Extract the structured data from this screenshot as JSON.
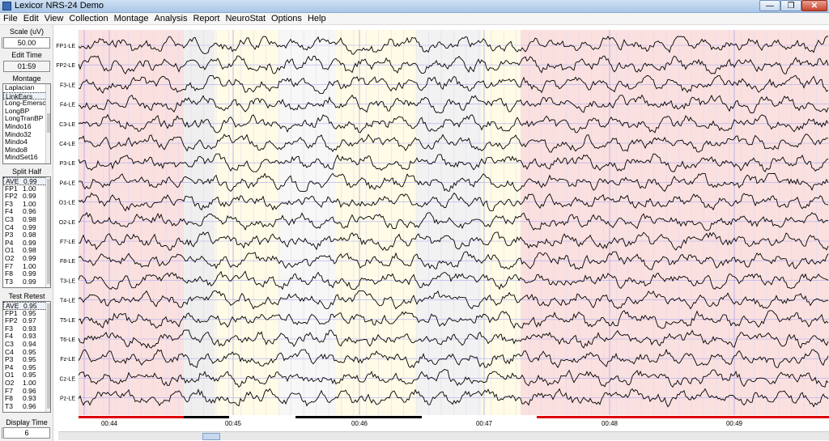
{
  "window": {
    "title": "Lexicor NRS-24 Demo"
  },
  "menu": [
    "File",
    "Edit",
    "View",
    "Collection",
    "Montage",
    "Analysis",
    "Report",
    "NeuroStat",
    "Options",
    "Help"
  ],
  "panel": {
    "scale_label": "Scale (uV)",
    "scale_value": "50.00",
    "edit_time_label": "Edit Time",
    "edit_time_value": "01:59",
    "montage_label": "Montage",
    "montages": [
      "Laplacian",
      "LinkEars",
      "Long-Emerson",
      "LongBP",
      "LongTranBP",
      "Mindo16",
      "Mindo32",
      "Mindo4",
      "Mindo8",
      "MindSet16"
    ],
    "montage_selected": 1,
    "split_half_label": "Split Half",
    "split_half": [
      [
        "AVE",
        "0.99"
      ],
      [
        "FP1",
        "1.00"
      ],
      [
        "FP2",
        "0.99"
      ],
      [
        "F3",
        "1.00"
      ],
      [
        "F4",
        "0.96"
      ],
      [
        "C3",
        "0.98"
      ],
      [
        "C4",
        "0.99"
      ],
      [
        "P3",
        "0.98"
      ],
      [
        "P4",
        "0.99"
      ],
      [
        "O1",
        "0.98"
      ],
      [
        "O2",
        "0.99"
      ],
      [
        "F7",
        "1.00"
      ],
      [
        "F8",
        "0.99"
      ],
      [
        "T3",
        "0.99"
      ]
    ],
    "test_retest_label": "Test Retest",
    "test_retest": [
      [
        "AVE",
        "0.95"
      ],
      [
        "FP1",
        "0.95"
      ],
      [
        "FP2",
        "0.97"
      ],
      [
        "F3",
        "0.93"
      ],
      [
        "F4",
        "0.93"
      ],
      [
        "C3",
        "0.94"
      ],
      [
        "C4",
        "0.95"
      ],
      [
        "P3",
        "0.95"
      ],
      [
        "P4",
        "0.95"
      ],
      [
        "O1",
        "0.95"
      ],
      [
        "O2",
        "1.00"
      ],
      [
        "F7",
        "0.96"
      ],
      [
        "F8",
        "0.93"
      ],
      [
        "T3",
        "0.96"
      ]
    ],
    "display_time_label": "Display Time",
    "display_time_value": "6"
  },
  "eeg": {
    "channels": [
      "FP1-LE",
      "FP2-LE",
      "F3-LE",
      "F4-LE",
      "C3-LE",
      "C4-LE",
      "P3-LE",
      "P4-LE",
      "O1-LE",
      "O2-LE",
      "F7-LE",
      "F8-LE",
      "T3-LE",
      "T4-LE",
      "T5-LE",
      "T6-LE",
      "Fz-LE",
      "Cz-LE",
      "Pz-LE"
    ],
    "time_labels": [
      "00:44",
      "00:45",
      "00:46",
      "00:47",
      "00:48",
      "00:49"
    ],
    "colors": {
      "rejected_region": "#fbe0e0",
      "grey_region": "#efefef",
      "yellow_region": "#fffbe6",
      "grid_line": "#a9a9ee",
      "trace": "#000000",
      "marker_red": "#dd0000",
      "marker_black": "#000000"
    }
  }
}
